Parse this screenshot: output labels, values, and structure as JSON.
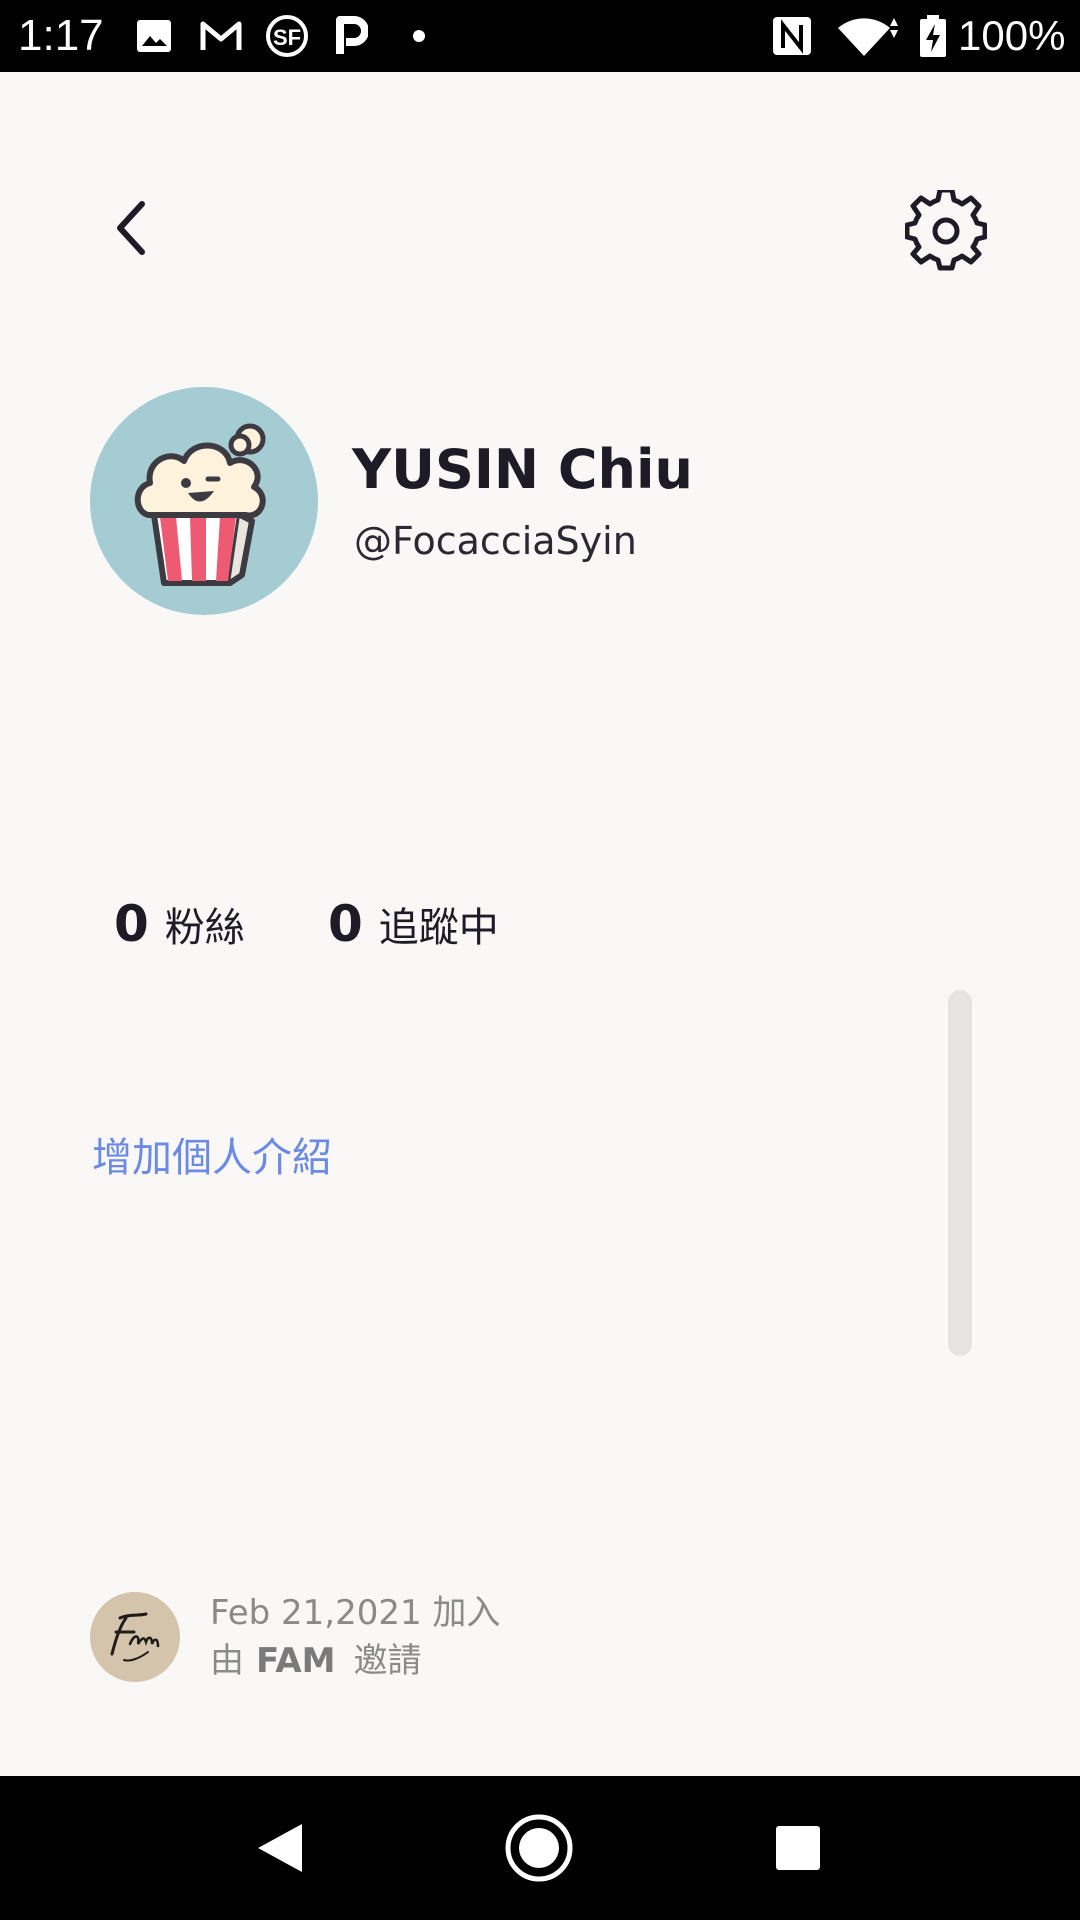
{
  "status_bar": {
    "time": "1:17",
    "battery": "100%",
    "icons": [
      "photo-icon",
      "gmail-icon",
      "sf-icon",
      "p-app-icon",
      "dot-icon",
      "nfc-icon",
      "wifi-icon",
      "battery-charging-icon"
    ]
  },
  "header": {
    "back_icon": "chevron-left-icon",
    "settings_icon": "gear-icon"
  },
  "profile": {
    "display_name": "YUSIN Chiu",
    "username": "@FocacciaSyin",
    "avatar_icon": "popcorn-avatar",
    "avatar_bg": "#a6ccd3"
  },
  "stats": {
    "followers_count": "0",
    "followers_label": "粉絲",
    "following_count": "0",
    "following_label": "追蹤中"
  },
  "bio": {
    "add_bio_label": "增加個人介紹",
    "link_color": "#6a8ae6"
  },
  "footer": {
    "joined_text": "Feb 21,2021 加入",
    "invited_prefix": "由",
    "inviter_name": "FAM",
    "invited_suffix": "邀請",
    "inviter_avatar_icon": "fam-logo"
  },
  "nav_bar": {
    "icons": [
      "nav-back-icon",
      "nav-home-icon",
      "nav-recents-icon"
    ]
  }
}
